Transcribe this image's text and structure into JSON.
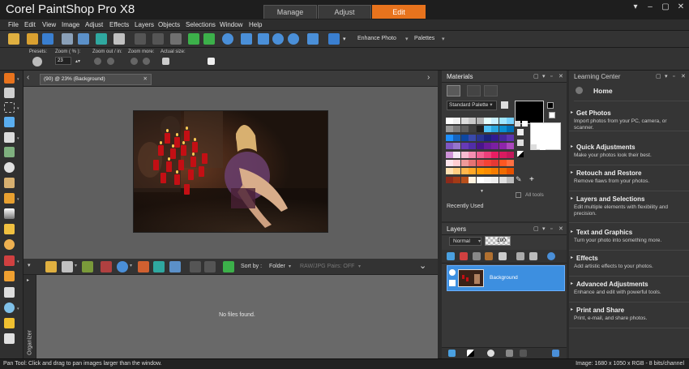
{
  "app": {
    "title": "Corel PaintShop Pro X8"
  },
  "workspace_tabs": [
    {
      "label": "Manage"
    },
    {
      "label": "Adjust"
    },
    {
      "label": "Edit"
    }
  ],
  "menu": [
    "File",
    "Edit",
    "View",
    "Image",
    "Adjust",
    "Effects",
    "Layers",
    "Objects",
    "Selections",
    "Window",
    "Help"
  ],
  "toolbar": {
    "enhance_photo": "Enhance Photo",
    "palettes": "Palettes"
  },
  "tool_options": {
    "presets": "Presets:",
    "zoom_label": "Zoom ( % ):",
    "zoom_value": "23",
    "zoom_out_in": "Zoom out / in:",
    "zoom_more": "Zoom more:",
    "actual_size": "Actual size:"
  },
  "document": {
    "tab_label": "(90) @  23% (Background)"
  },
  "organizer": {
    "label": "Organizer",
    "sort_by": "Sort by :",
    "sort_value": "Folder",
    "raw_jpg": "RAW/JPG Pairs: OFF",
    "no_files": "No files found."
  },
  "materials": {
    "title": "Materials",
    "palette_select": "Standard Palette",
    "recently_used": "Recently Used",
    "all_tools": "All tools",
    "swatch_colors": [
      [
        "#ffffff",
        "#f0f0f0",
        "#dcdcdc",
        "#c8c8c8",
        "#b4b4b4",
        "#e6ffff",
        "#c8f0ff",
        "#a0e6ff",
        "#78d2ff"
      ],
      [
        "#9a9a9a",
        "#7c7c7c",
        "#5e5e5e",
        "#404040",
        "#202020",
        "#4fc3f7",
        "#29a8e0",
        "#0a8fd2",
        "#0070b8"
      ],
      [
        "#1e90ff",
        "#1565c0",
        "#0d47a1",
        "#3949ab",
        "#283593",
        "#1a237e",
        "#311b92",
        "#4527a0",
        "#5e35b1"
      ],
      [
        "#7e57c2",
        "#9575cd",
        "#673ab7",
        "#512da8",
        "#4a148c",
        "#6a1b9a",
        "#7b1fa2",
        "#8e24aa",
        "#ab47bc"
      ],
      [
        "#ce93d8",
        "#f3e5f5",
        "#f8bbd0",
        "#f48fb1",
        "#f06292",
        "#ec407a",
        "#e91e63",
        "#d81b60",
        "#c2185b"
      ],
      [
        "#fce4ec",
        "#ffcdd2",
        "#ef9a9a",
        "#e57373",
        "#ef5350",
        "#f44336",
        "#e53935",
        "#ff5722",
        "#ff7043"
      ],
      [
        "#ffe0b2",
        "#ffcc80",
        "#ffb74d",
        "#ffa726",
        "#ff9800",
        "#fb8c00",
        "#f57c00",
        "#ef6c00",
        "#e65100"
      ],
      [
        "#8d2a1a",
        "#a33a16",
        "#b8501c",
        "#fff3e0",
        "#ffffff",
        "#f5f5f5",
        "#eeeeee",
        "#e0e0e0",
        "#bdbdbd"
      ]
    ]
  },
  "layers": {
    "title": "Layers",
    "blend_mode": "Normal",
    "opacity": "100",
    "layer_name": "Background"
  },
  "learning_center": {
    "title": "Learning Center",
    "home": "Home",
    "items": [
      {
        "title": "Get Photos",
        "desc": "Import photos from your PC, camera, or scanner."
      },
      {
        "title": "Quick Adjustments",
        "desc": "Make your photos look their best."
      },
      {
        "title": "Retouch and Restore",
        "desc": "Remove flaws from your photos."
      },
      {
        "title": "Layers and Selections",
        "desc": "Edit multiple elements with flexibility and precision."
      },
      {
        "title": "Text and Graphics",
        "desc": "Turn your photo into something more."
      },
      {
        "title": "Effects",
        "desc": "Add artistic effects to your photos."
      },
      {
        "title": "Advanced Adjustments",
        "desc": "Enhance and edit with powerful tools."
      },
      {
        "title": "Print and Share",
        "desc": "Print, e-mail, and share photos."
      }
    ]
  },
  "status": {
    "left": "Pan Tool: Click and drag to pan images larger than the window.",
    "right": "Image:  1680 x 1050 x RGB - 8 bits/channel"
  }
}
